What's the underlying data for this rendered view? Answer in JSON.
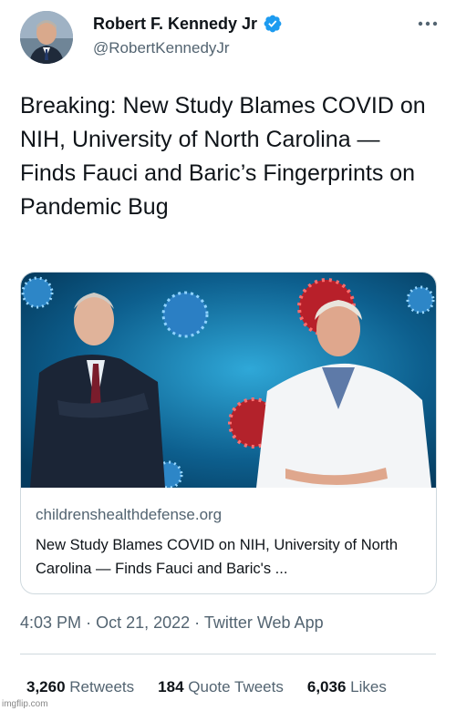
{
  "author": {
    "name": "Robert F. Kennedy Jr",
    "handle": "@RobertKennedyJr",
    "verified": true
  },
  "menu_icon": "more-dots-icon",
  "tweet": {
    "text": "Breaking: New Study Blames COVID on NIH, University of North Carolina — Finds Fauci and Baric’s Fingerprints on Pandemic Bug"
  },
  "card": {
    "domain": "childrenshealthdefense.org",
    "title": "New Study Blames COVID on NIH, University of North Carolina — Finds Fauci and Baric's ..."
  },
  "meta": {
    "time": "4:03 PM",
    "date": "Oct 21, 2022",
    "source": "Twitter Web App",
    "separator": "·"
  },
  "stats": [
    {
      "value": "3,260",
      "label": "Retweets"
    },
    {
      "value": "184",
      "label": "Quote Tweets"
    },
    {
      "value": "6,036",
      "label": "Likes"
    }
  ],
  "watermark": "imgflip.com",
  "colors": {
    "verified_blue": "#1d9bf0",
    "secondary_text": "#536471",
    "border": "#cfd9de"
  }
}
